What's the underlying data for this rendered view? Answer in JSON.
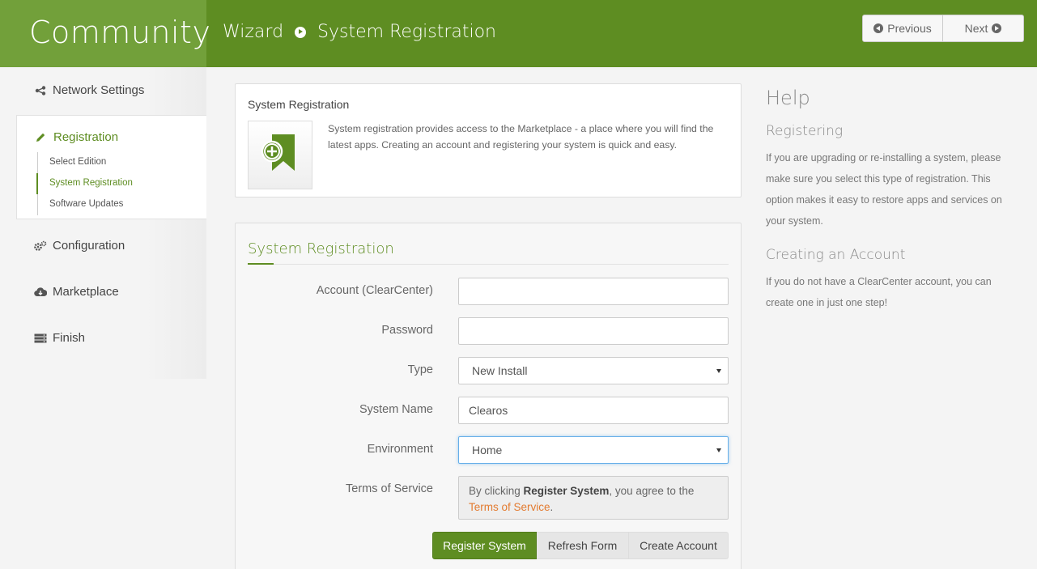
{
  "header": {
    "brand": "Community",
    "breadcrumb_root": "Wizard",
    "breadcrumb_current": "System Registration",
    "prev_label": "Previous",
    "next_label": "Next"
  },
  "sidebar": {
    "items": [
      {
        "label": "Network Settings",
        "icon": "share-icon"
      },
      {
        "label": "Registration",
        "icon": "pencil-icon"
      },
      {
        "label": "Configuration",
        "icon": "gears-icon"
      },
      {
        "label": "Marketplace",
        "icon": "cloud-download-icon"
      },
      {
        "label": "Finish",
        "icon": "server-icon"
      }
    ],
    "registration_steps": [
      "Select Edition",
      "System Registration",
      "Software Updates"
    ]
  },
  "intro": {
    "title": "System Registration",
    "icon": "bookmark-plus-icon",
    "text": "System registration provides access to the Marketplace - a place where you will find the latest apps. Creating an account and registering your system is quick and easy."
  },
  "form": {
    "title": "System Registration",
    "account_label": "Account (ClearCenter)",
    "account_value": "",
    "password_label": "Password",
    "password_value": "",
    "type_label": "Type",
    "type_value": "New Install",
    "system_name_label": "System Name",
    "system_name_value": "Clearos",
    "environment_label": "Environment",
    "environment_value": "Home",
    "tos_label": "Terms of Service",
    "tos_prefix": "By clicking ",
    "tos_bold": "Register System",
    "tos_middle": ", you agree to the ",
    "tos_link": "Terms of Service",
    "tos_suffix": ".",
    "register_label": "Register System",
    "refresh_label": "Refresh Form",
    "create_label": "Create Account"
  },
  "help": {
    "title": "Help",
    "sections": [
      {
        "heading": "Registering",
        "text": "If you are upgrading or re-installing a system, please make sure you select this type of registration. This option makes it easy to restore apps and services on your system."
      },
      {
        "heading": "Creating an Account",
        "text": "If you do not have a ClearCenter account, you can create one in just one step!"
      }
    ]
  },
  "colors": {
    "brand_green": "#5e8d22",
    "brand_green_light": "#72a03a",
    "link_orange": "#e37b30"
  }
}
